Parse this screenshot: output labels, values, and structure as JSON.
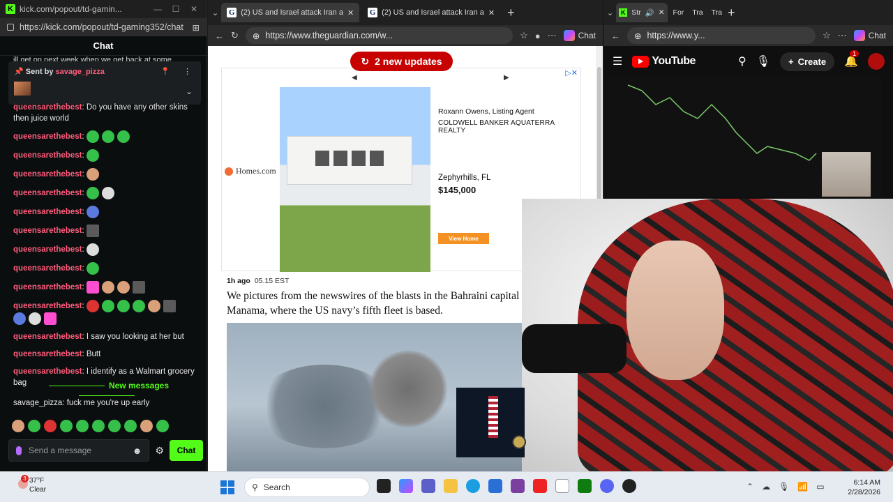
{
  "kick": {
    "window_title": "kick.com/popout/td-gamin...",
    "url": "https://kick.com/popout/td-gaming352/chat",
    "chat_title": "Chat",
    "cutoff_text": "ill get on next week when we get back at some",
    "pinned": {
      "label": "Sent by",
      "user": "savage_pizza"
    },
    "messages": [
      {
        "user": "queensarethebest",
        "text": "Do you have any other skins then juice world"
      },
      {
        "user": "queensarethebest",
        "text": ""
      },
      {
        "user": "queensarethebest",
        "text": ""
      },
      {
        "user": "queensarethebest",
        "text": ""
      },
      {
        "user": "queensarethebest",
        "text": ""
      },
      {
        "user": "queensarethebest",
        "text": ""
      },
      {
        "user": "queensarethebest",
        "text": ""
      },
      {
        "user": "queensarethebest",
        "text": ""
      },
      {
        "user": "queensarethebest",
        "text": ""
      },
      {
        "user": "queensarethebest",
        "text": ""
      },
      {
        "user": "queensarethebest",
        "text": ""
      },
      {
        "user": "queensarethebest",
        "text": "I saw you looking at her but"
      },
      {
        "user": "queensarethebest",
        "text": "Butt"
      },
      {
        "user": "queensarethebest",
        "text": "I identify as a Walmart grocery bag"
      }
    ],
    "new_messages_label": "New messages",
    "last_message": {
      "user": "savage_pizza",
      "text": "fuck me you're up early"
    },
    "input_placeholder": "Send a message",
    "chat_button": "Chat",
    "colors": {
      "accent": "#53fc18",
      "username": "#ff5c7c"
    }
  },
  "edge_left": {
    "tabs": [
      {
        "label": "(2) US and Israel attack Iran a"
      },
      {
        "label": "(2) US and Israel attack Iran a"
      }
    ],
    "url": "https://www.theguardian.com/w...",
    "copilot_label": "Chat"
  },
  "guardian": {
    "updates_button": "2 new updates",
    "ad": {
      "brand": "Homes.com",
      "agent": "Roxann Owens, Listing Agent",
      "agency": "COLDWELL BANKER AQUATERRA REALTY",
      "location": "Zephyrhills, FL",
      "price": "$145,000",
      "cta": "View Home"
    },
    "time_ago": "1h ago",
    "timestamp": "05.15 EST",
    "headline": "We pictures from the newswires of the blasts in the Bahraini capital Manama, where the US navy’s fifth fleet is based."
  },
  "edge_right": {
    "tabs": [
      {
        "label": "Str"
      },
      {
        "label": "For"
      },
      {
        "label": "Tra"
      },
      {
        "label": "Tra"
      }
    ],
    "url": "https://www.y...",
    "copilot_label": "Chat",
    "youtube": {
      "logo_text": "YouTube",
      "create_label": "Create",
      "notification_count": "1"
    }
  },
  "taskbar": {
    "weather_temp": "37°F",
    "weather_desc": "Clear",
    "weather_badge": "3",
    "search_placeholder": "Search",
    "time": "6:14 AM",
    "date": "2/28/2026"
  }
}
